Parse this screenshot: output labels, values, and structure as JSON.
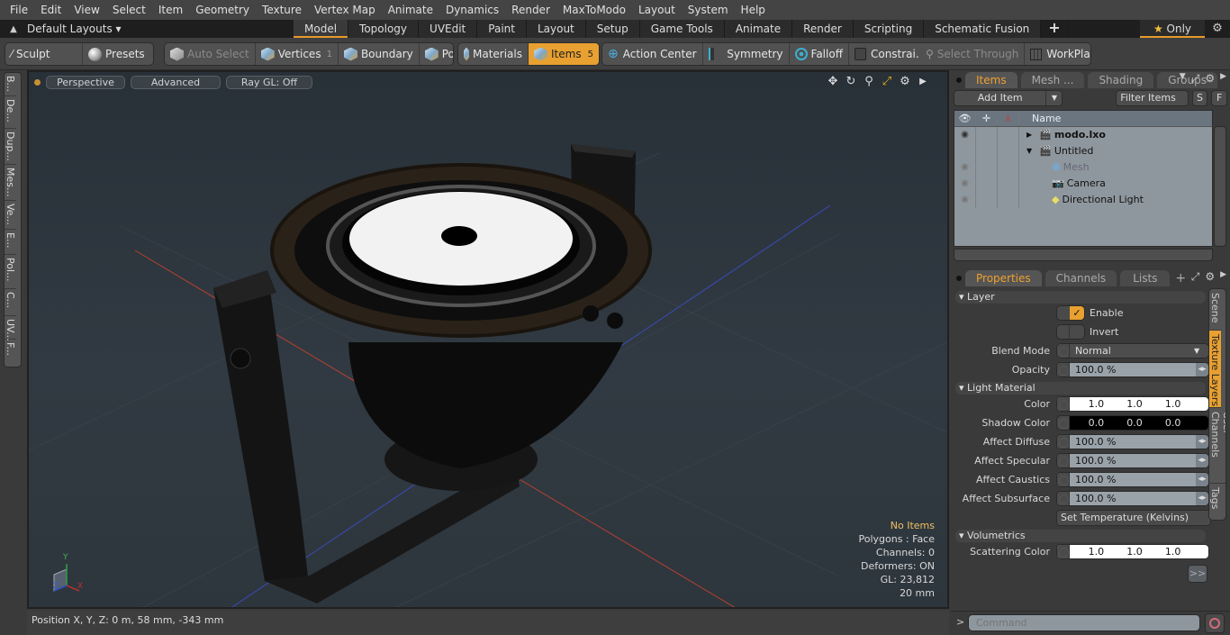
{
  "menu": [
    "File",
    "Edit",
    "View",
    "Select",
    "Item",
    "Geometry",
    "Texture",
    "Vertex Map",
    "Animate",
    "Dynamics",
    "Render",
    "MaxToModo",
    "Layout",
    "System",
    "Help"
  ],
  "layout_bar": {
    "default_layouts": "Default Layouts ▾",
    "tabs": [
      "Model",
      "Topology",
      "UVEdit",
      "Paint",
      "Layout",
      "Setup",
      "Game Tools",
      "Animate",
      "Render",
      "Scripting",
      "Schematic Fusion"
    ],
    "active_tab": "Model",
    "add_tab": "+",
    "only_label": "Only",
    "star": "★"
  },
  "toolbar": {
    "sculpt": "Sculpt",
    "presets": "Presets",
    "auto_select": "Auto Select",
    "vertices": "Vertices",
    "vertices_count": "1",
    "boundary": "Boundary",
    "polygons": "Polygons",
    "materials": "Materials",
    "items": "Items",
    "items_count": "5",
    "action_center": "Action Center",
    "symmetry": "Symmetry",
    "falloff": "Falloff",
    "constraints": "Constrai...",
    "select_through": "Select Through",
    "workplane": "WorkPlane"
  },
  "left_tabs": [
    "B...",
    "De...",
    "Dup...",
    "Mes...",
    "Ve...",
    "E...",
    "Pol...",
    "C...",
    "UV...",
    "F..."
  ],
  "viewport": {
    "view": "Perspective",
    "shading": "Advanced",
    "raygl": "Ray GL: Off",
    "info": {
      "selection": "No Items",
      "polygons": "Polygons : Face",
      "channels": "Channels: 0",
      "deformers": "Deformers: ON",
      "gl": "GL: 23,812",
      "scale": "20 mm"
    },
    "axis_labels": {
      "x": "X",
      "y": "Y",
      "z": "Z"
    }
  },
  "status": {
    "position": "Position X, Y, Z:   0 m, 58 mm, -343 mm"
  },
  "items_panel": {
    "tabs": [
      "Items",
      "Mesh ...",
      "Shading",
      "Groups"
    ],
    "active_tab": "Items",
    "add_item": "Add Item",
    "filter": "Filter Items",
    "s_btn": "S",
    "f_btn": "F",
    "name_header": "Name",
    "rows": [
      {
        "name": "modo.lxo",
        "bold": true,
        "vis": true
      },
      {
        "name": "Untitled",
        "bold": false,
        "vis": false
      },
      {
        "name": "Mesh",
        "dim": true,
        "vis": true
      },
      {
        "name": "Camera",
        "vis": true
      },
      {
        "name": "Directional Light",
        "vis": true
      }
    ]
  },
  "properties_panel": {
    "tabs": [
      "Properties",
      "Channels",
      "Lists"
    ],
    "active_tab": "Properties",
    "sections": {
      "layer": "Layer",
      "light_material": "Light Material",
      "volumetrics": "Volumetrics"
    },
    "enable_label": "Enable",
    "enable_checked": true,
    "invert_label": "Invert",
    "invert_checked": false,
    "blend_mode_label": "Blend Mode",
    "blend_mode": "Normal",
    "opacity_label": "Opacity",
    "opacity": "100.0 %",
    "color_label": "Color",
    "color": [
      "1.0",
      "1.0",
      "1.0"
    ],
    "shadow_color_label": "Shadow Color",
    "shadow_color": [
      "0.0",
      "0.0",
      "0.0"
    ],
    "affect_diffuse_label": "Affect Diffuse",
    "affect_diffuse": "100.0 %",
    "affect_specular_label": "Affect Specular",
    "affect_specular": "100.0 %",
    "affect_caustics_label": "Affect Caustics",
    "affect_caustics": "100.0 %",
    "affect_subsurface_label": "Affect Subsurface",
    "affect_subsurface": "100.0 %",
    "set_temperature": "Set Temperature (Kelvins)",
    "scattering_color_label": "Scattering Color",
    "scattering_color": [
      "1.0",
      "1.0",
      "1.0"
    ],
    "more": ">>",
    "side_tabs": [
      "Scene",
      "Texture Layers",
      "User Channels",
      "Tags"
    ],
    "active_side_tab": "Texture Layers"
  },
  "command": {
    "prompt": ">",
    "placeholder": "Command"
  },
  "colors": {
    "accent": "#e8a030",
    "panel": "#3a3a3a",
    "tree_bg": "#8f979e"
  }
}
